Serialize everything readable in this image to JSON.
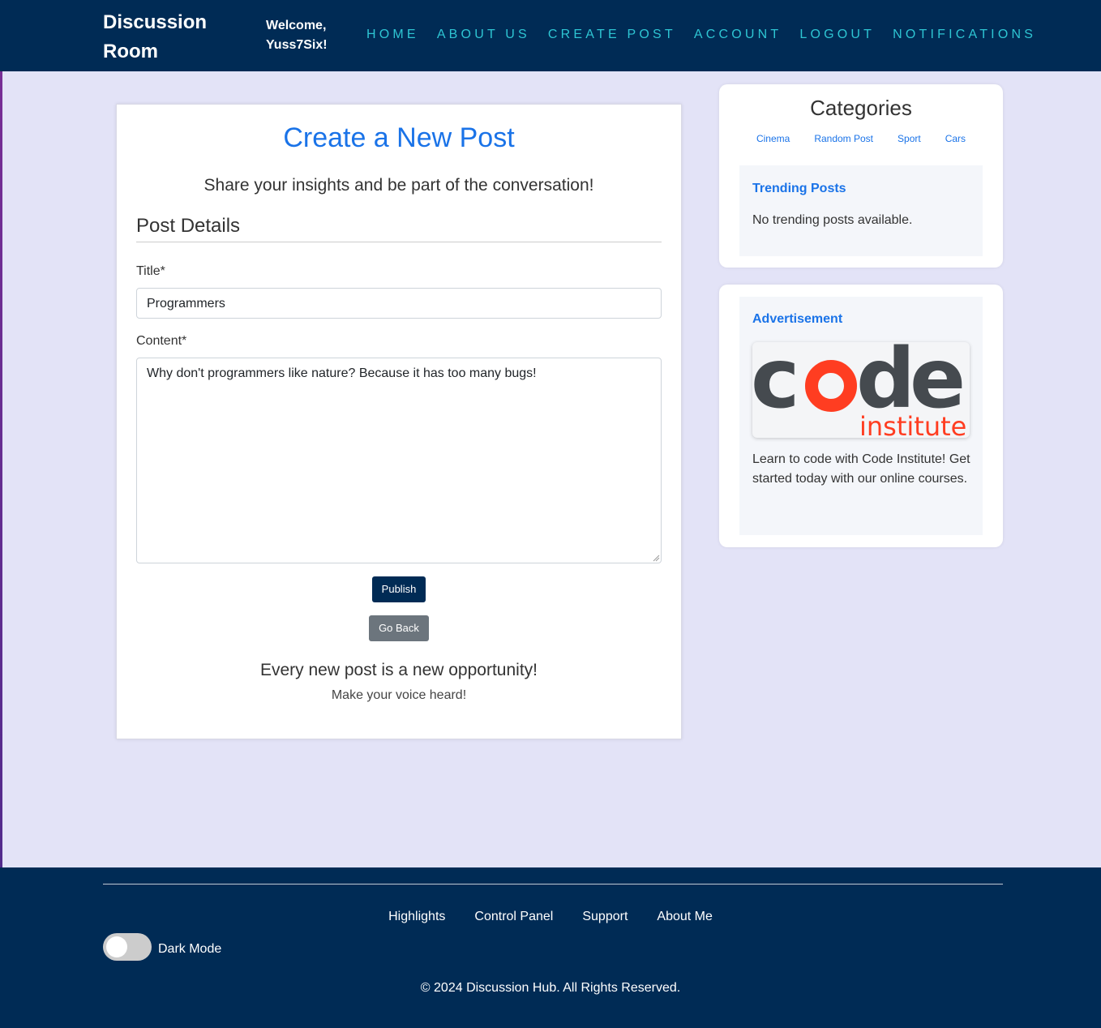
{
  "header": {
    "brand": "Discussion Room",
    "welcome_line1": "Welcome,",
    "welcome_line2": "Yuss7Six!",
    "nav": [
      "HOME",
      "ABOUT US",
      "CREATE POST",
      "ACCOUNT",
      "LOGOUT",
      "NOTIFICATIONS"
    ]
  },
  "post_form": {
    "title": "Create a New Post",
    "subtitle": "Share your insights and be part of the conversation!",
    "section": "Post Details",
    "title_label": "Title*",
    "title_value": "Programmers",
    "content_label": "Content*",
    "content_value": "Why don't programmers like nature? Because it has too many bugs!",
    "publish_label": "Publish",
    "back_label": "Go Back",
    "footer_line1": "Every new post is a new opportunity!",
    "footer_line2": "Make your voice heard!"
  },
  "sidebar": {
    "categories_title": "Categories",
    "categories": [
      "Cinema",
      "Random Post",
      "Sport",
      "Cars"
    ],
    "trending_title": "Trending Posts",
    "trending_empty": "No trending posts available.",
    "ad_title": "Advertisement",
    "ad_logo_word": "code",
    "ad_logo_sub": "institute",
    "ad_text": "Learn to code with Code Institute! Get started today with our online courses."
  },
  "footer": {
    "links": [
      "Highlights",
      "Control Panel",
      "Support",
      "About Me"
    ],
    "dark_mode_label": "Dark Mode",
    "copyright": "© 2024 Discussion Hub. All Rights Reserved."
  },
  "colors": {
    "navy": "#002b55",
    "accent_blue": "#1a73e8",
    "nav_cyan": "#2ec5d3",
    "logo_red": "#ff3d21"
  }
}
